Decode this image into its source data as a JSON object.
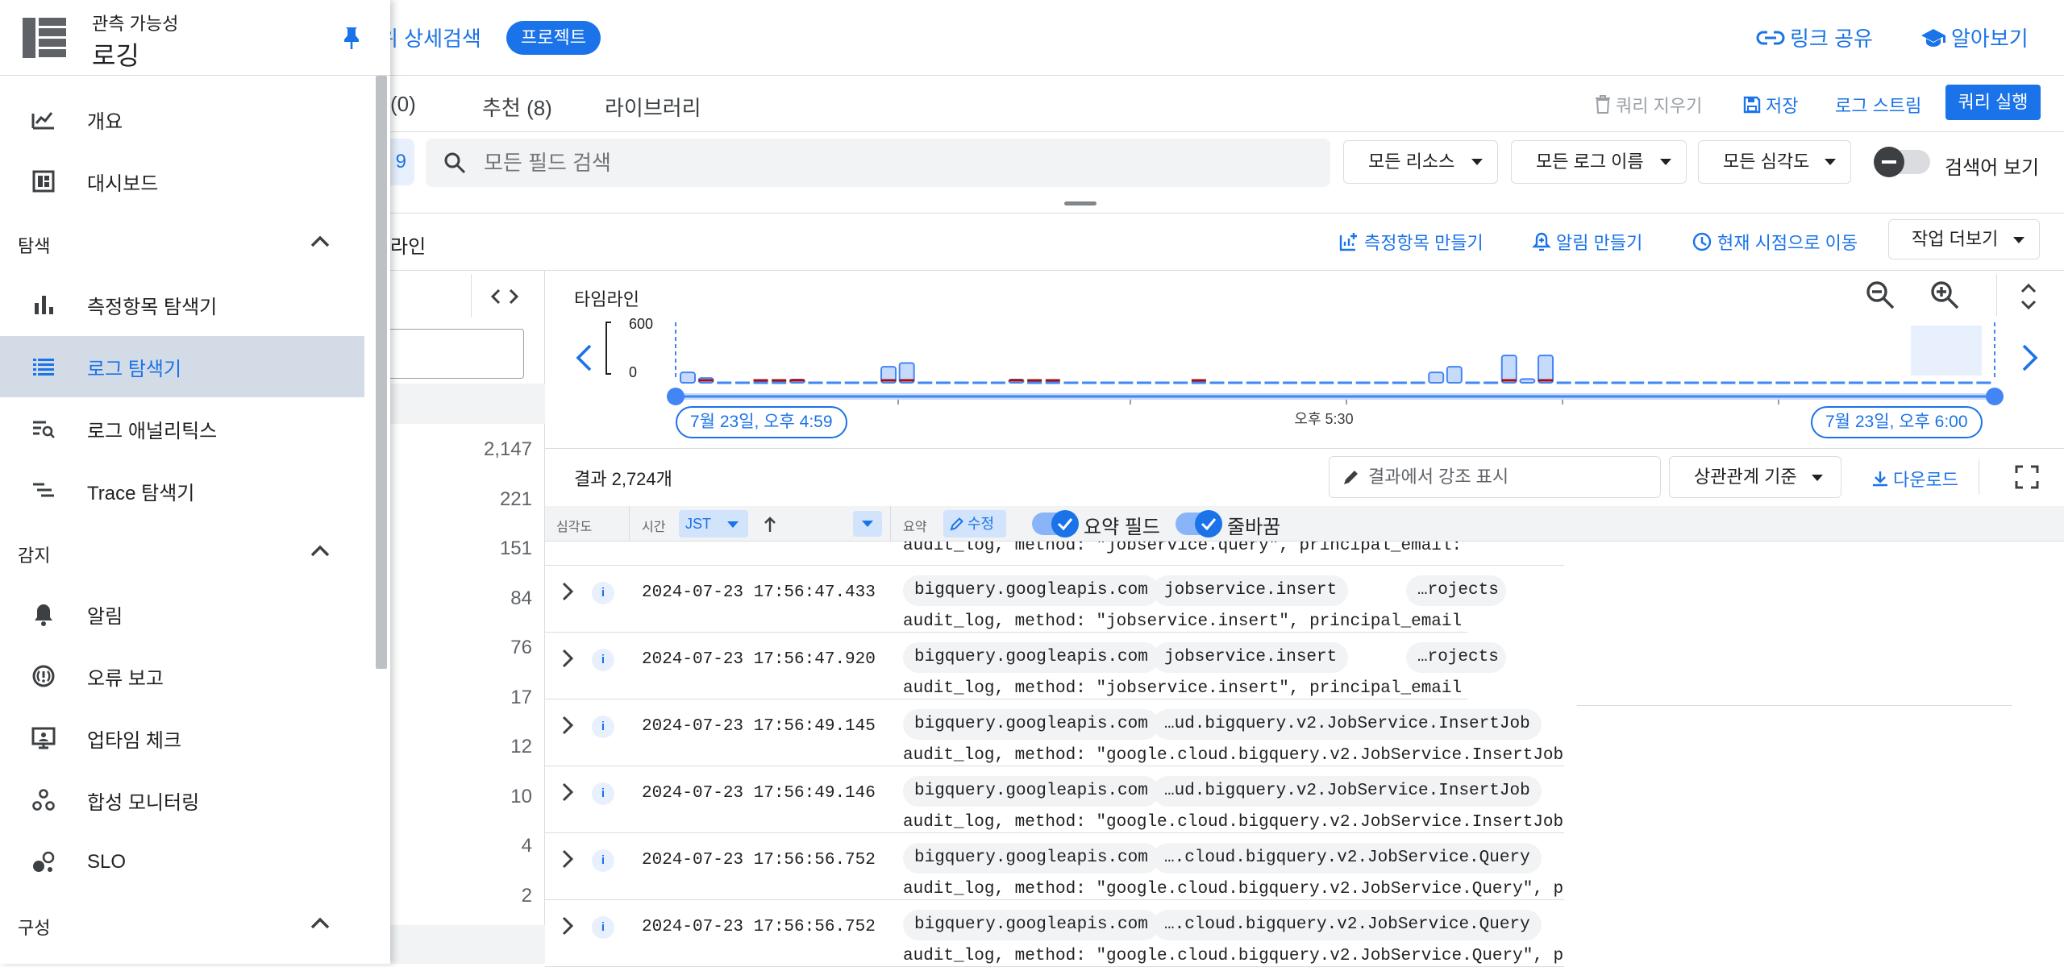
{
  "header": {
    "scope_link": "위 상세검색",
    "project_badge": "프로젝트",
    "share_link": "링크 공유",
    "learn": "알아보기"
  },
  "query_tabs": {
    "recent": "(0)",
    "recent_prefix": "",
    "recommended": "추천 (8)",
    "library": "라이브러리",
    "clear": "쿼리 지우기",
    "save": "저장",
    "stream": "로그 스트림",
    "run": "쿼리 실행"
  },
  "search": {
    "chip_partial": "9",
    "placeholder": "모든 필드 검색",
    "resources": "모든 리소스",
    "log_names": "모든 로그 이름",
    "severities": "모든 심각도",
    "show_query": "검색어 보기"
  },
  "actions": {
    "partial_label": "라인",
    "create_metric": "측정항목 만들기",
    "create_alert": "알림 만들기",
    "jump_now": "현재 시점으로 이동",
    "more": "작업 더보기"
  },
  "fields": {
    "counts": [
      "2,147",
      "221",
      "151",
      "84",
      "76",
      "17",
      "12",
      "10",
      "4",
      "2"
    ]
  },
  "timeline": {
    "label": "타임라인",
    "y_max": "600",
    "y_min": "0",
    "start_time": "7월 23일, 오후 4:59",
    "mid_time": "오후 5:30",
    "end_time": "7월 23일, 오후 6:00",
    "bars_blue": [
      110,
      50,
      0,
      0,
      0,
      0,
      20,
      0,
      0,
      0,
      0,
      170,
      210,
      0,
      0,
      0,
      0,
      0,
      20,
      0,
      0,
      0,
      0,
      0,
      0,
      0,
      0,
      0,
      0,
      0,
      0,
      0,
      0,
      0,
      0,
      0,
      0,
      0,
      0,
      0,
      0,
      110,
      170,
      0,
      0,
      290,
      40,
      290,
      0,
      0,
      0,
      0,
      0,
      0,
      0,
      0,
      0,
      0,
      0,
      0,
      0,
      0,
      0,
      0,
      0,
      0,
      0,
      0,
      0,
      0,
      0,
      0
    ],
    "colors": {
      "bar": "#c6dafc",
      "bar_edge": "#4285f4",
      "error": "#a50e0e",
      "range": "#4285f4"
    }
  },
  "results": {
    "count": "결과 2,724개",
    "highlight_placeholder": "결과에서 강조 표시",
    "sort": "상관관계 기준",
    "download": "다운로드"
  },
  "table": {
    "col_severity": "심각도",
    "col_time": "시간",
    "timezone": "JST",
    "col_summary": "요약",
    "edit": "수정",
    "summary_fields": "요약 필드",
    "wrap": "줄바꿈",
    "top_partial": "audit_log, method: \"jobservice.query\", principal_email:",
    "rows": [
      {
        "ts": "2024-07-23 17:56:47.433",
        "chip1": "bigquery.googleapis.com",
        "chip2": "jobservice.insert",
        "chip3": "…rojects",
        "summary": "audit_log, method: \"jobservice.insert\", principal_email"
      },
      {
        "ts": "2024-07-23 17:56:47.920",
        "chip1": "bigquery.googleapis.com",
        "chip2": "jobservice.insert",
        "chip3": "…rojects",
        "summary": "audit_log, method: \"jobservice.insert\", principal_email"
      },
      {
        "ts": "2024-07-23 17:56:49.145",
        "chip1": "bigquery.googleapis.com",
        "chip2": "…ud.bigquery.v2.JobService.InsertJob",
        "chip3": "",
        "summary": "audit_log, method: \"google.cloud.bigquery.v2.JobService.InsertJob"
      },
      {
        "ts": "2024-07-23 17:56:49.146",
        "chip1": "bigquery.googleapis.com",
        "chip2": "…ud.bigquery.v2.JobService.InsertJob",
        "chip3": "",
        "summary": "audit_log, method: \"google.cloud.bigquery.v2.JobService.InsertJob"
      },
      {
        "ts": "2024-07-23 17:56:56.752",
        "chip1": "bigquery.googleapis.com",
        "chip2": "….cloud.bigquery.v2.JobService.Query",
        "chip3": "",
        "summary": "audit_log, method: \"google.cloud.bigquery.v2.JobService.Query\", p"
      },
      {
        "ts": "2024-07-23 17:56:56.752",
        "chip1": "bigquery.googleapis.com",
        "chip2": "….cloud.bigquery.v2.JobService.Query",
        "chip3": "",
        "summary": "audit_log, method: \"google.cloud.bigquery.v2.JobService.Query\", p"
      }
    ]
  },
  "drawer": {
    "product_group": "관측 가능성",
    "product": "로깅",
    "items": [
      {
        "label": "개요",
        "icon": "chart-line-icon"
      },
      {
        "label": "대시보드",
        "icon": "dashboard-icon"
      }
    ],
    "section_explore": "탐색",
    "explore_items": [
      {
        "label": "측정항목 탐색기",
        "icon": "bar-chart-icon"
      },
      {
        "label": "로그 탐색기",
        "icon": "logs-icon",
        "active": true
      },
      {
        "label": "로그 애널리틱스",
        "icon": "log-search-icon"
      },
      {
        "label": "Trace 탐색기",
        "icon": "trace-icon"
      }
    ],
    "section_detect": "감지",
    "detect_items": [
      {
        "label": "알림",
        "icon": "bell-icon"
      },
      {
        "label": "오류 보고",
        "icon": "error-reporting-icon"
      },
      {
        "label": "업타임 체크",
        "icon": "monitor-icon"
      },
      {
        "label": "합성 모니터링",
        "icon": "synthetic-icon"
      },
      {
        "label": "SLO",
        "icon": "slo-icon"
      }
    ],
    "section_config": "구성"
  }
}
